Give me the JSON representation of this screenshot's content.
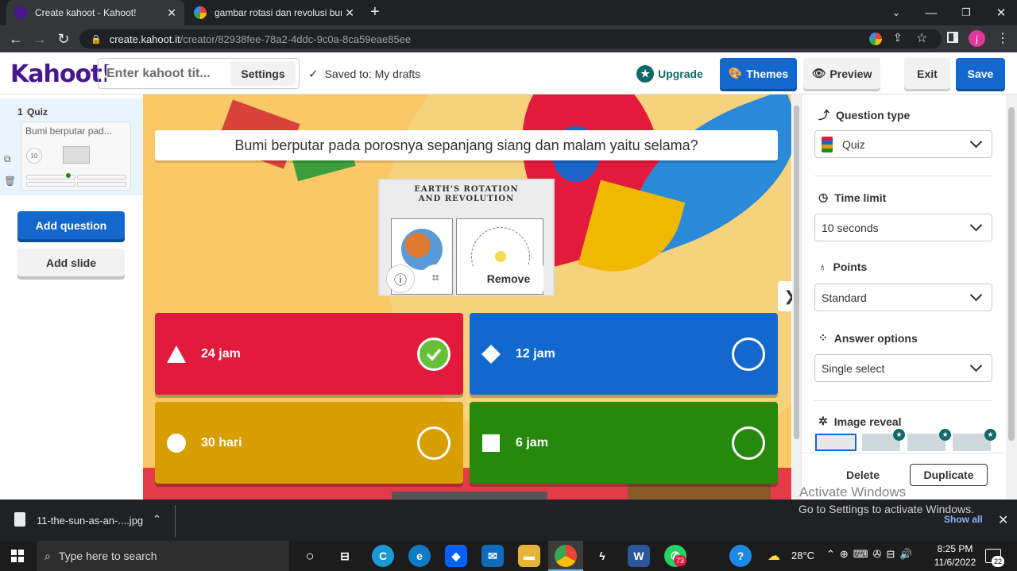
{
  "browser": {
    "tabs": [
      {
        "title": "Create kahoot - Kahoot!"
      },
      {
        "title": "gambar rotasi dan revolusi bumi"
      }
    ],
    "url_host": "create.kahoot.it",
    "url_path": "/creator/82938fee-78a2-4ddc-9c0a-8ca59eae85ee",
    "profile_initial": "j"
  },
  "header": {
    "logo": "Kahoot!",
    "title_placeholder": "Enter kahoot tit...",
    "settings_label": "Settings",
    "saved_text": "Saved to: My drafts",
    "upgrade_label": "Upgrade",
    "themes_label": "Themes",
    "preview_label": "Preview",
    "exit_label": "Exit",
    "save_label": "Save"
  },
  "sidebar": {
    "slide_number": "1",
    "slide_type": "Quiz",
    "slide_preview_text": "Bumi berputar pad...",
    "slide_timer": "10",
    "add_question_label": "Add question",
    "add_slide_label": "Add slide"
  },
  "question": {
    "text": "Bumi berputar pada porosnya sepanjang siang dan malam yaitu selama?",
    "image_title_line1": "Earth's Rotation",
    "image_title_line2": "and Revolution",
    "image_remove_label": "Remove",
    "answers": [
      {
        "text": "24 jam",
        "color": "#e21b3c",
        "shape": "triangle",
        "correct": true
      },
      {
        "text": "12 jam",
        "color": "#1368ce",
        "shape": "diamond",
        "correct": false
      },
      {
        "text": "30 hari",
        "color": "#d89e00",
        "shape": "circle",
        "correct": false
      },
      {
        "text": "6 jam",
        "color": "#26890c",
        "shape": "square",
        "correct": false
      }
    ]
  },
  "panel": {
    "question_type_label": "Question type",
    "question_type_value": "Quiz",
    "time_limit_label": "Time limit",
    "time_limit_value": "10 seconds",
    "points_label": "Points",
    "points_value": "Standard",
    "answer_options_label": "Answer options",
    "answer_options_value": "Single select",
    "image_reveal_label": "Image reveal",
    "delete_label": "Delete",
    "duplicate_label": "Duplicate"
  },
  "watermark": {
    "line1": "Activate Windows",
    "line2": "Go to Settings to activate Windows."
  },
  "downloads": {
    "file": "11-the-sun-as-an-....jpg",
    "show_all": "Show all"
  },
  "taskbar": {
    "search_placeholder": "Type here to search",
    "temperature": "28°C",
    "time": "8:25 PM",
    "date": "11/6/2022",
    "whatsapp_badge": "73",
    "notification_count": "22"
  }
}
